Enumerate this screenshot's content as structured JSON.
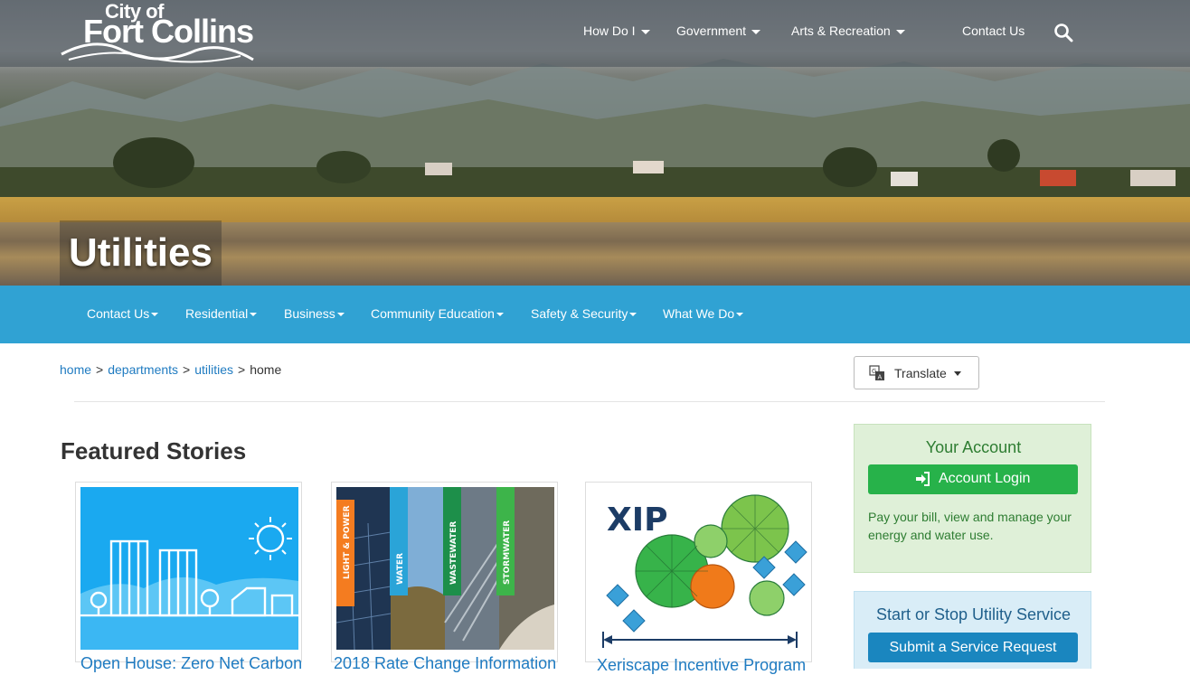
{
  "header": {
    "logo_city": "City of",
    "logo_name": "Fort Collins",
    "nav": [
      "How Do I",
      "Government",
      "Arts & Recreation",
      "Contact Us"
    ],
    "page_title": "Utilities"
  },
  "subnav": [
    "Contact Us",
    "Residential",
    "Business",
    "Community Education",
    "Safety & Security",
    "What We Do"
  ],
  "breadcrumb": {
    "items": [
      "home",
      "departments",
      "utilities"
    ],
    "current": "home",
    "separator": ">"
  },
  "translate": {
    "label": "Translate"
  },
  "featured": {
    "title": "Featured Stories",
    "cards": [
      {
        "title": "Open House: Zero Net Carbon"
      },
      {
        "title": "2018 Rate Change Information",
        "banners": [
          "LIGHT & POWER",
          "WATER",
          "WASTEWATER",
          "STORMWATER"
        ]
      },
      {
        "title": "Xeriscape Incentive Program",
        "image_text": "XIP"
      }
    ]
  },
  "account": {
    "title": "Your Account",
    "button": "Account Login",
    "description": "Pay your bill, view and manage your energy and water use."
  },
  "service": {
    "title": "Start or Stop Utility Service",
    "button": "Submit a Service Request"
  },
  "colors": {
    "accent_blue": "#30a2d3",
    "link_blue": "#1f7bc1",
    "green_button": "#27b24a",
    "blue_button": "#1a86bf"
  }
}
